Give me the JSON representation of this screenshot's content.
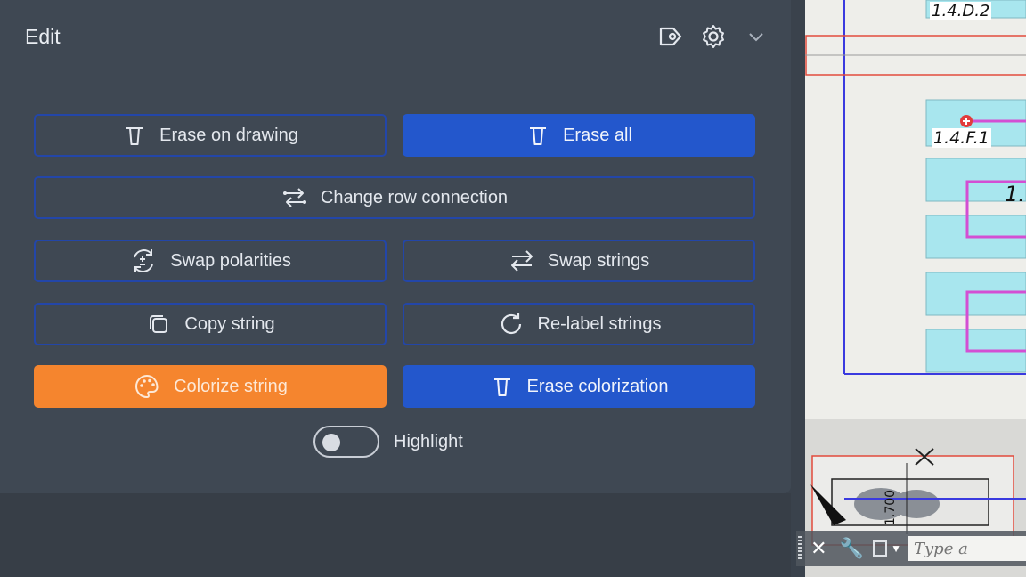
{
  "panel": {
    "title": "Edit",
    "header_icons": [
      "tag-icon",
      "gear-icon",
      "chevron-down-icon"
    ]
  },
  "buttons": {
    "erase_on_drawing": "Erase on drawing",
    "erase_all": "Erase all",
    "change_row_connection": "Change row connection",
    "swap_polarities": "Swap polarities",
    "swap_strings": "Swap strings",
    "copy_string": "Copy string",
    "relabel_strings": "Re-label strings",
    "colorize_string": "Colorize string",
    "erase_colorization": "Erase colorization"
  },
  "highlight": {
    "label": "Highlight",
    "enabled": false
  },
  "drawing": {
    "labels": [
      "1.4.D.2",
      "1.4.F.1",
      "1.",
      "1.700"
    ]
  },
  "command_bar": {
    "placeholder": "Type a"
  },
  "colors": {
    "panel_bg": "#3f4853",
    "primary": "#2357cc",
    "outline": "#2346a8",
    "accent_orange": "#f5852e"
  }
}
